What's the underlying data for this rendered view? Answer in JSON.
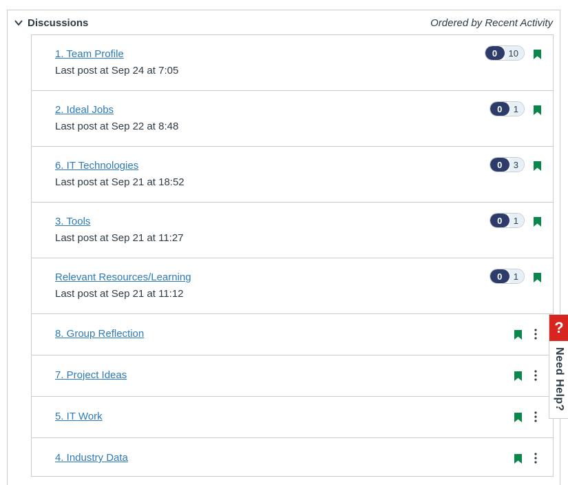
{
  "header": {
    "title": "Discussions",
    "order_label": "Ordered by Recent Activity"
  },
  "discussions": [
    {
      "title": "1. Team Profile",
      "last_post": "Last post at Sep 24 at 7:05",
      "unread": "0",
      "total": "10"
    },
    {
      "title": "2. Ideal Jobs",
      "last_post": "Last post at Sep 22 at 8:48",
      "unread": "0",
      "total": "1"
    },
    {
      "title": "6. IT Technologies",
      "last_post": "Last post at Sep 21 at 18:52",
      "unread": "0",
      "total": "3"
    },
    {
      "title": "3. Tools",
      "last_post": "Last post at Sep 21 at 11:27",
      "unread": "0",
      "total": "1"
    },
    {
      "title": "Relevant Resources/Learning",
      "last_post": "Last post at Sep 21 at 11:12",
      "unread": "0",
      "total": "1"
    },
    {
      "title": "8. Group Reflection"
    },
    {
      "title": "7. Project Ideas"
    },
    {
      "title": "5. IT Work"
    },
    {
      "title": "4. Industry Data"
    }
  ],
  "help": {
    "icon": "?",
    "label": "Need Help?"
  },
  "colors": {
    "link": "#2b7abc",
    "published": "#0b874b",
    "unread_badge": "#2d3b6b",
    "help": "#d9251f"
  }
}
